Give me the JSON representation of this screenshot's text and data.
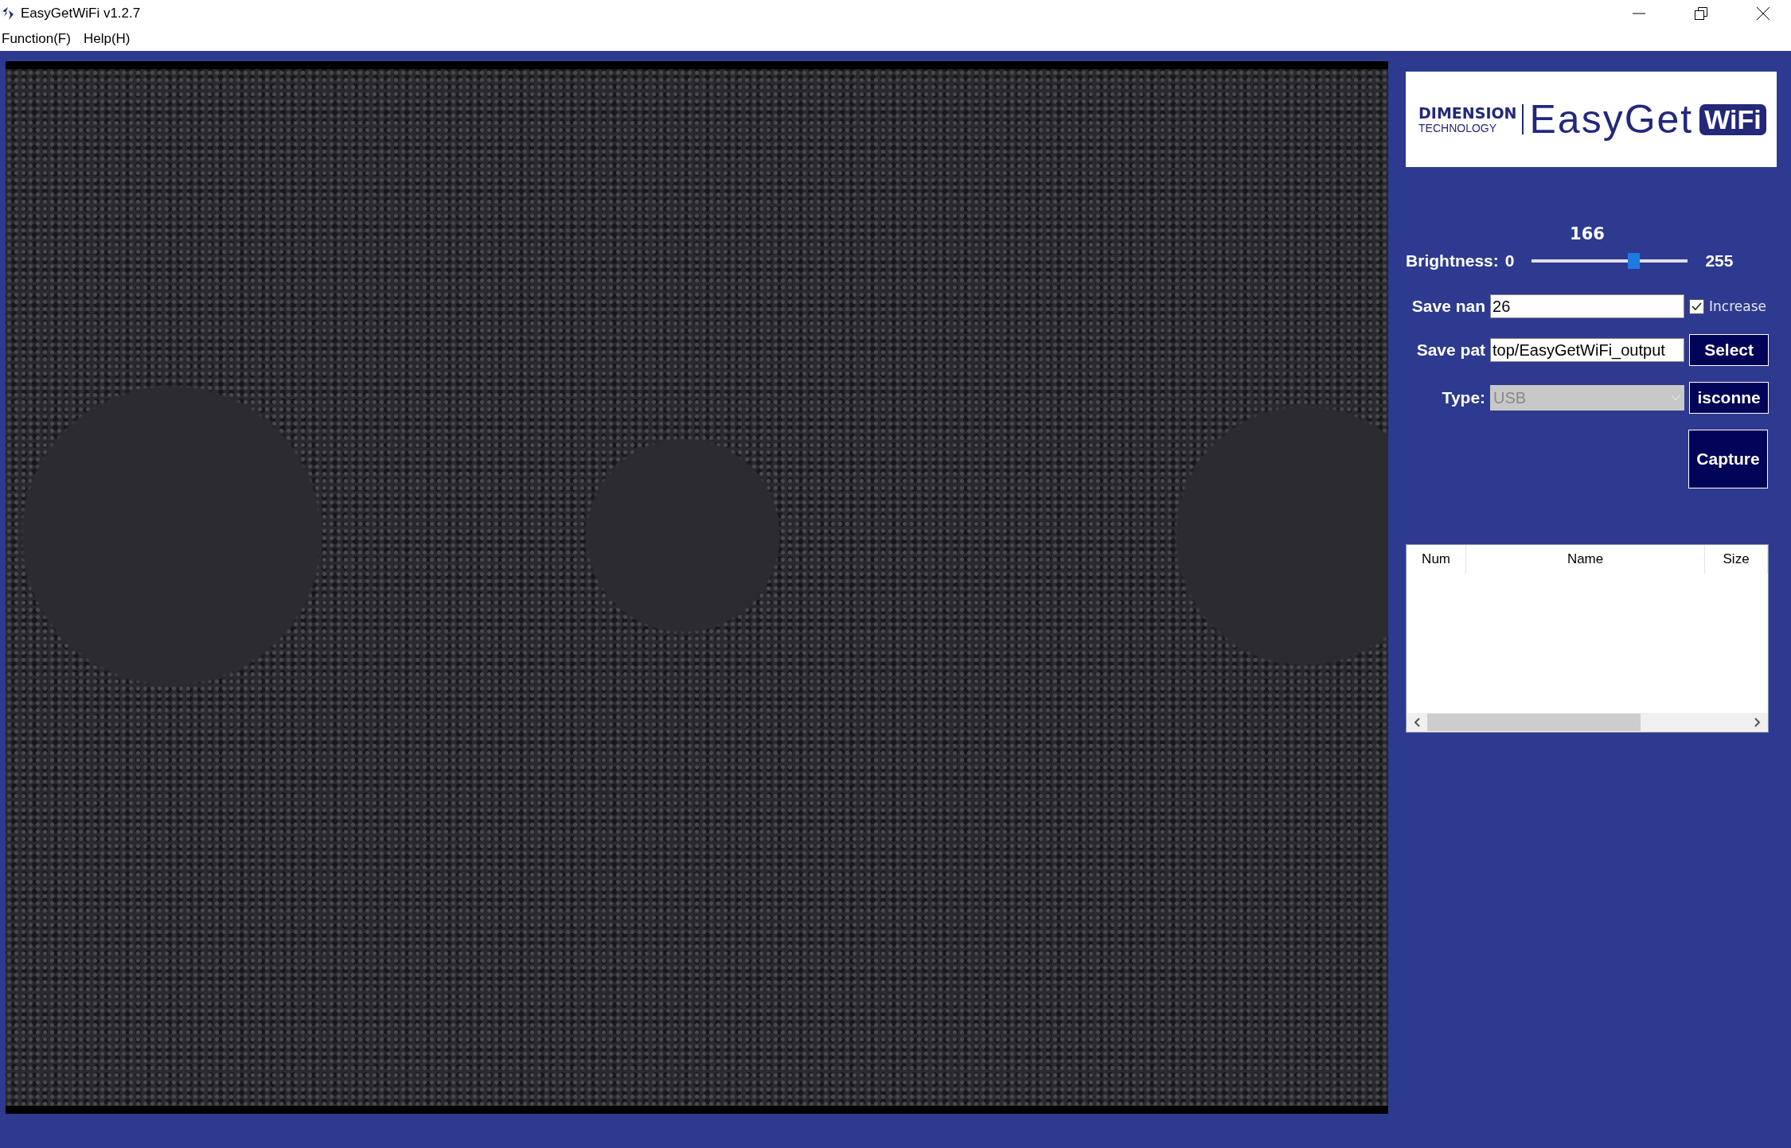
{
  "window": {
    "title": "EasyGetWiFi v1.2.7"
  },
  "menu": [
    {
      "label": "Function(F)"
    },
    {
      "label": "Help(H)"
    }
  ],
  "logo": {
    "company": "DIMENSION",
    "subtitle": "TECHNOLOGY",
    "product": "EasyGet",
    "badge": "WiFi"
  },
  "brightness": {
    "label": "Brightness:",
    "min": "0",
    "max": "255",
    "reading": "166",
    "level": 0.651
  },
  "save_name": {
    "label": "Save nan",
    "value": "26",
    "increase": {
      "label": "Increase",
      "checked": true
    }
  },
  "save_path": {
    "label": "Save pat",
    "value": "top/EasyGetWiFi_output",
    "button": "Select"
  },
  "type": {
    "label": "Type:",
    "value": "USB",
    "disabled": true,
    "button": "isconne"
  },
  "capture_button": "Capture",
  "table": {
    "columns": [
      "Num",
      "Name",
      "Size"
    ]
  }
}
